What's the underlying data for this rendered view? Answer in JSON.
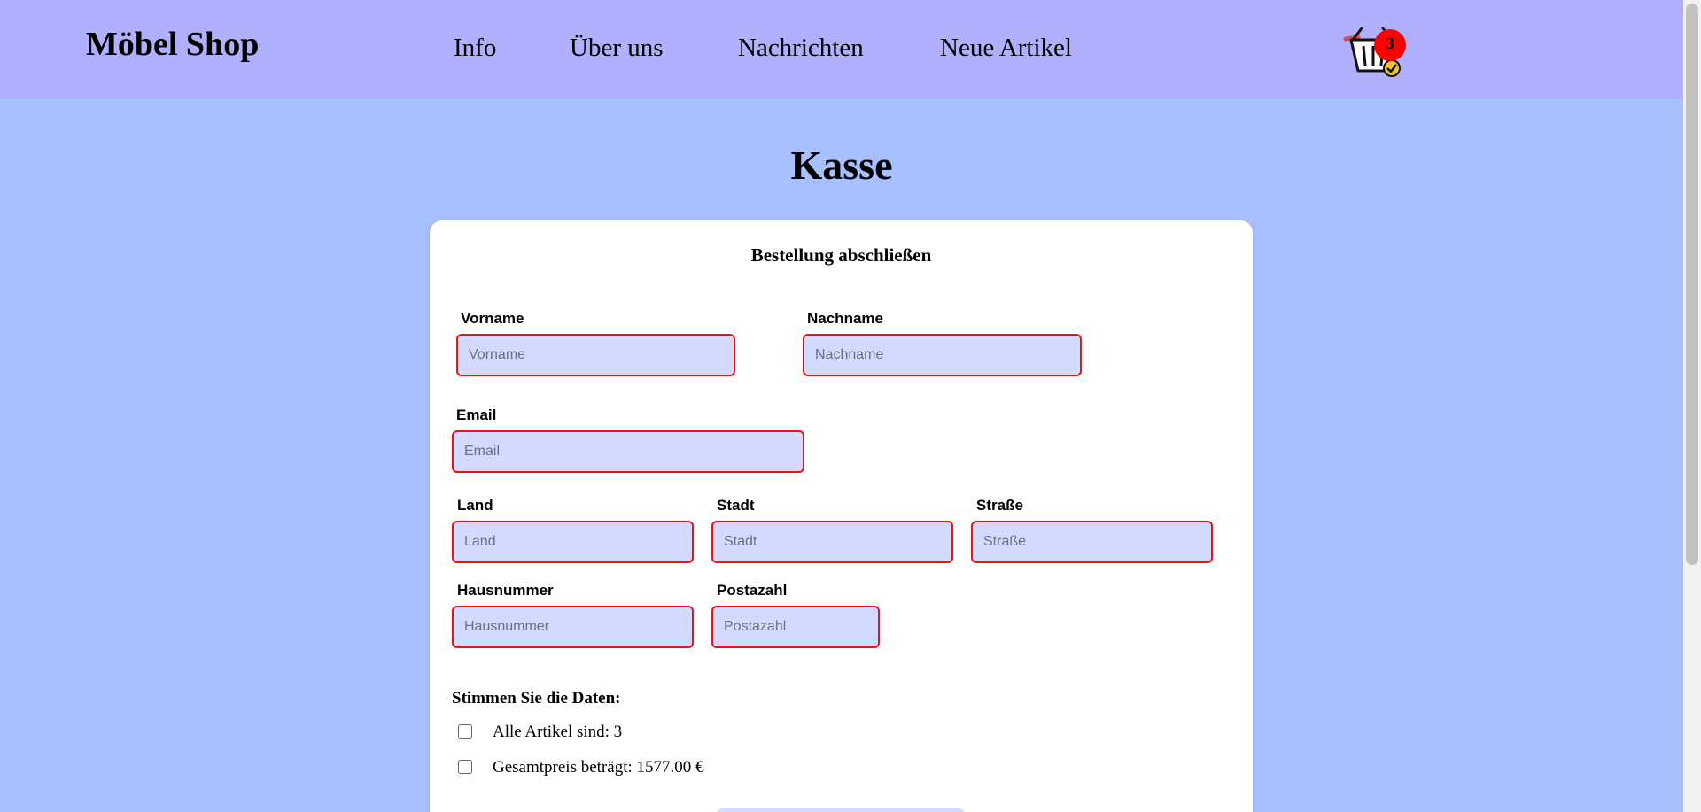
{
  "header": {
    "logo": "Möbel Shop",
    "nav": [
      "Info",
      "Über uns",
      "Nachrichten",
      "Neue Artikel"
    ],
    "cart_count": "3",
    "cart_icon": "basket-icon"
  },
  "page_title": "Kasse",
  "form": {
    "title": "Bestellung abschließen",
    "fields": {
      "vorname": {
        "label": "Vorname",
        "placeholder": "Vorname",
        "value": ""
      },
      "nachname": {
        "label": "Nachname",
        "placeholder": "Nachname",
        "value": ""
      },
      "email": {
        "label": "Email",
        "placeholder": "Email",
        "value": ""
      },
      "land": {
        "label": "Land",
        "placeholder": "Land",
        "value": ""
      },
      "stadt": {
        "label": "Stadt",
        "placeholder": "Stadt",
        "value": ""
      },
      "strasse": {
        "label": "Straße",
        "placeholder": "Straße",
        "value": ""
      },
      "hausnummer": {
        "label": "Hausnummer",
        "placeholder": "Hausnummer",
        "value": ""
      },
      "postazahl": {
        "label": "Postazahl",
        "placeholder": "Postazahl",
        "value": ""
      }
    },
    "confirm": {
      "title": "Stimmen Sie die Daten:",
      "items": [
        "Alle Artikel sind: 3",
        "Gesamtpreis beträgt: 1577.00 €"
      ],
      "checked": [
        false,
        false
      ]
    }
  },
  "colors": {
    "header_bg": "#b0b0fe",
    "page_bg": "#a9c0fe",
    "input_bg": "#d3d9ff",
    "input_border": "#ee1111",
    "badge": "#ff0000"
  }
}
